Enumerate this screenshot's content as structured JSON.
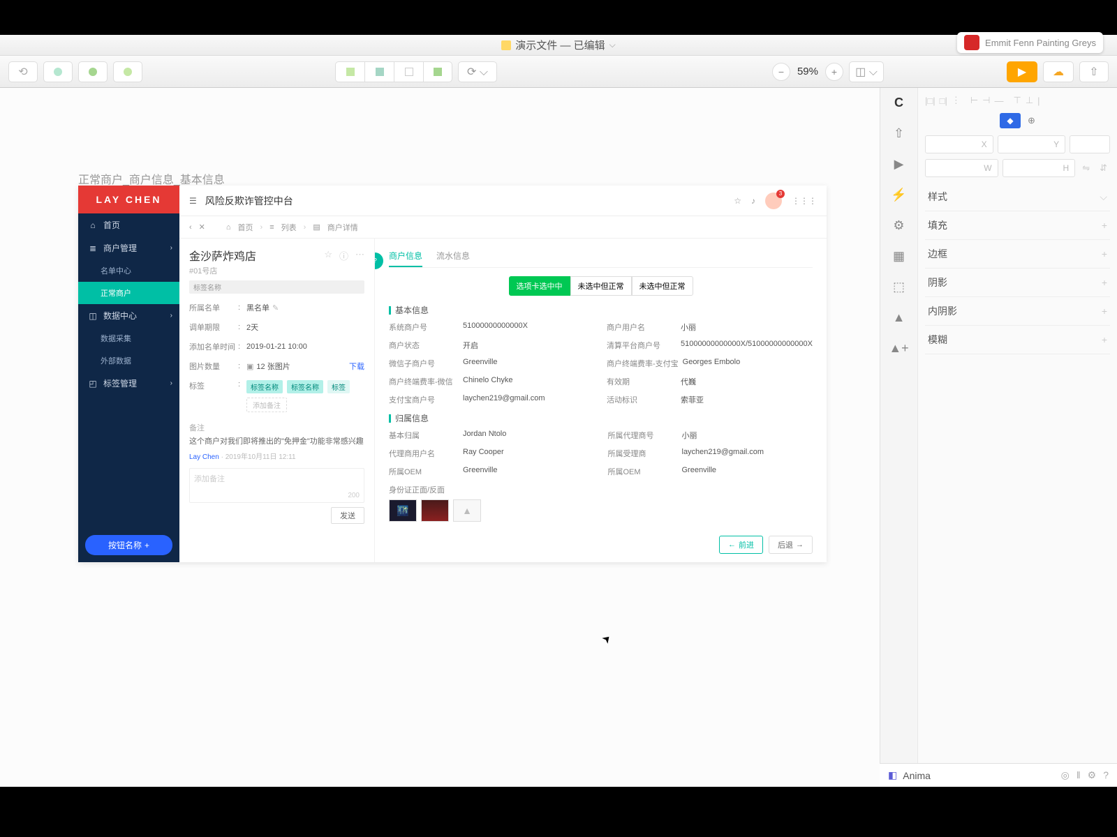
{
  "titlebar": {
    "title": "演示文件 — 已编辑"
  },
  "music": {
    "text": "Emmit Fenn    Painting Greys"
  },
  "zoom": {
    "value": "59%"
  },
  "inspector": {
    "pos": {
      "x": "X",
      "y": "Y",
      "w": "W",
      "h": "H"
    },
    "style": "样式",
    "sections": [
      "填充",
      "边框",
      "阴影",
      "内阴影",
      "模糊"
    ]
  },
  "anima": {
    "label": "Anima"
  },
  "mock": {
    "label_above": "正常商户_商户信息_基本信息",
    "logo": "LAY CHEN",
    "header_title": "风险反欺诈管控中台",
    "badge": "3",
    "nav": [
      {
        "icon": "⌂",
        "label": "首页"
      },
      {
        "icon": "≣",
        "label": "商户管理",
        "expand": true
      },
      {
        "sub": true,
        "label": "名单中心"
      },
      {
        "sub": true,
        "label": "正常商户",
        "active": true
      },
      {
        "icon": "◫",
        "label": "数据中心",
        "expand": true
      },
      {
        "sub": true,
        "label": "数据采集"
      },
      {
        "sub": true,
        "label": "外部数据"
      },
      {
        "icon": "◰",
        "label": "标签管理",
        "expand": true
      }
    ],
    "add_button": "按钮名称",
    "crumb": {
      "back": "‹",
      "close": "✕",
      "home": "首页",
      "list": "列表",
      "detail": "商户详情"
    },
    "left": {
      "shop": "金沙萨炸鸡店",
      "sub": "#01号店",
      "tag": "标签名称",
      "kv": [
        {
          "k": "所属名单",
          "v": "黑名单",
          "edit": true
        },
        {
          "k": "调单期限",
          "v": "2天"
        },
        {
          "k": "添加名单时间",
          "v": "2019-01-21 10:00"
        },
        {
          "k": "图片数量",
          "v": "12 张图片",
          "link": "下载",
          "icon": true
        },
        {
          "k": "标签",
          "tags": [
            "标签名称",
            "标签名称",
            "标签"
          ],
          "add": "添加备注"
        }
      ],
      "remark_label": "备注",
      "remark_text": "这个商户对我们即将推出的\"免押金\"功能非常感兴趣",
      "remark_author": "Lay Chen",
      "remark_time": "2019年10月11日 12:11",
      "remark_placeholder": "添加备注",
      "remark_count": "200",
      "send": "发送"
    },
    "right": {
      "tabs": [
        "商户信息",
        "流水信息"
      ],
      "pills": [
        "选项卡选中中",
        "未选中但正常",
        "未选中但正常"
      ],
      "section1": "基本信息",
      "fields1": [
        {
          "k": "系统商户号",
          "v": "51000000000000X"
        },
        {
          "k": "商户用户名",
          "v": "小丽"
        },
        {
          "k": "商户状态",
          "v": "开启"
        },
        {
          "k": "清算平台商户号",
          "v": "51000000000000X/51000000000000X"
        },
        {
          "k": "微信子商户号",
          "v": "Greenville"
        },
        {
          "k": "商户终端费率-支付宝",
          "v": "Georges Embolo"
        },
        {
          "k": "商户终端费率-微信",
          "v": "Chinelo Chyke"
        },
        {
          "k": "有效期",
          "v": "代巍"
        },
        {
          "k": "支付宝商户号",
          "v": "laychen219@gmail.com"
        },
        {
          "k": "活动标识",
          "v": "索菲亚"
        }
      ],
      "section2": "归属信息",
      "fields2": [
        {
          "k": "基本归属",
          "v": "Jordan Ntolo"
        },
        {
          "k": "所属代理商号",
          "v": "小丽"
        },
        {
          "k": "代理商用户名",
          "v": "Ray Cooper"
        },
        {
          "k": "所属受理商",
          "v": "laychen219@gmail.com"
        },
        {
          "k": "所属OEM",
          "v": "Greenville"
        },
        {
          "k": "所属OEM",
          "v": "Greenville"
        }
      ],
      "idcard": "身份证正面/反面",
      "prev": "前进",
      "next": "后退"
    }
  }
}
